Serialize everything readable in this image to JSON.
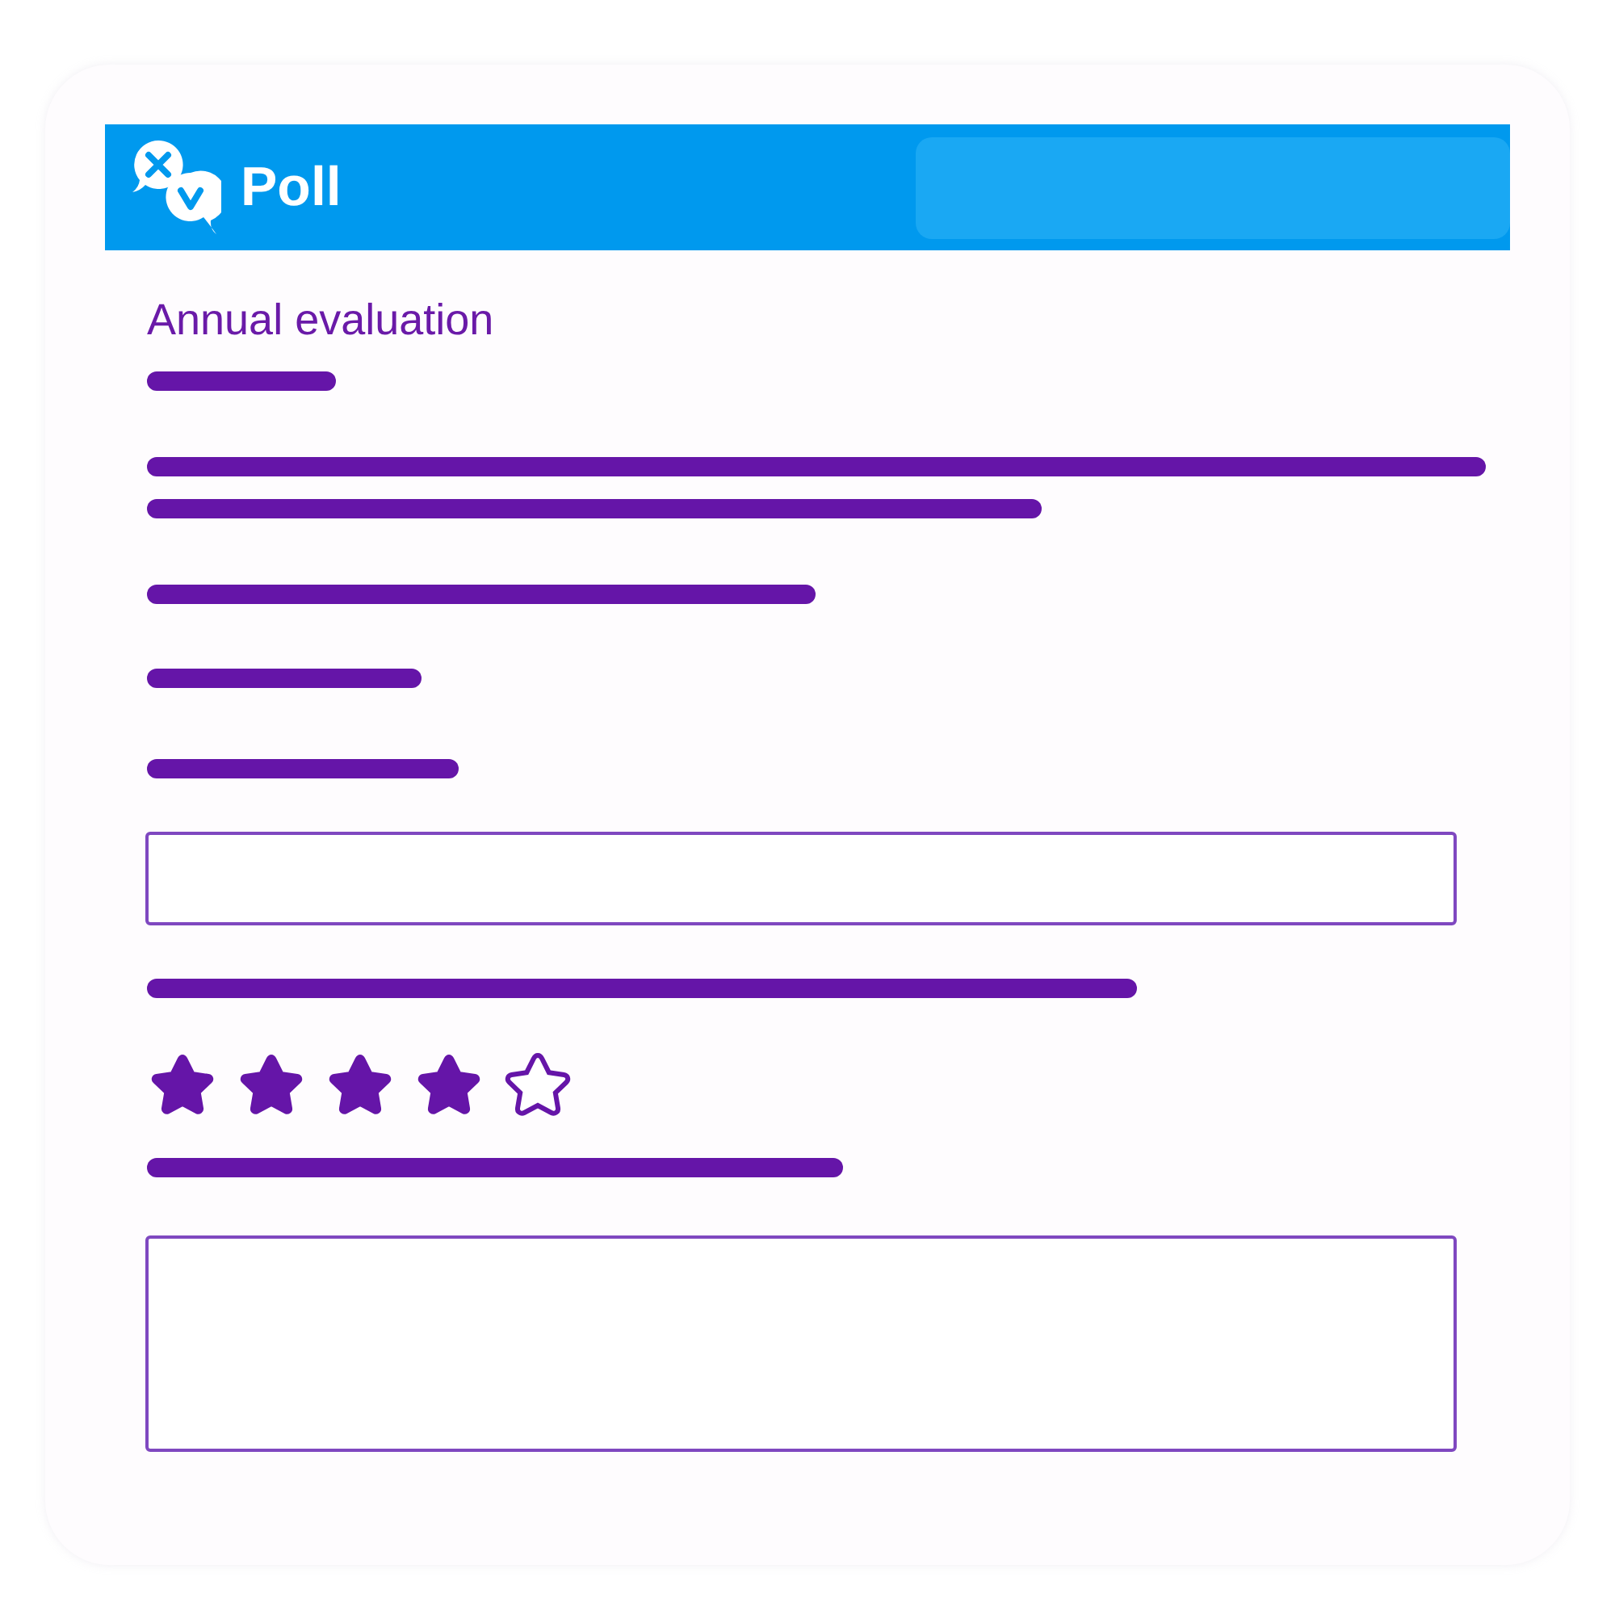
{
  "header": {
    "title": "Poll"
  },
  "form": {
    "title": "Annual evaluation",
    "items": [
      {
        "kind": "line"
      },
      {
        "kind": "line"
      },
      {
        "kind": "line"
      },
      {
        "kind": "line"
      },
      {
        "kind": "line"
      },
      {
        "kind": "line"
      },
      {
        "kind": "input"
      },
      {
        "kind": "line"
      },
      {
        "kind": "rating",
        "stars": 4
      },
      {
        "kind": "line"
      },
      {
        "kind": "textarea"
      }
    ]
  }
}
